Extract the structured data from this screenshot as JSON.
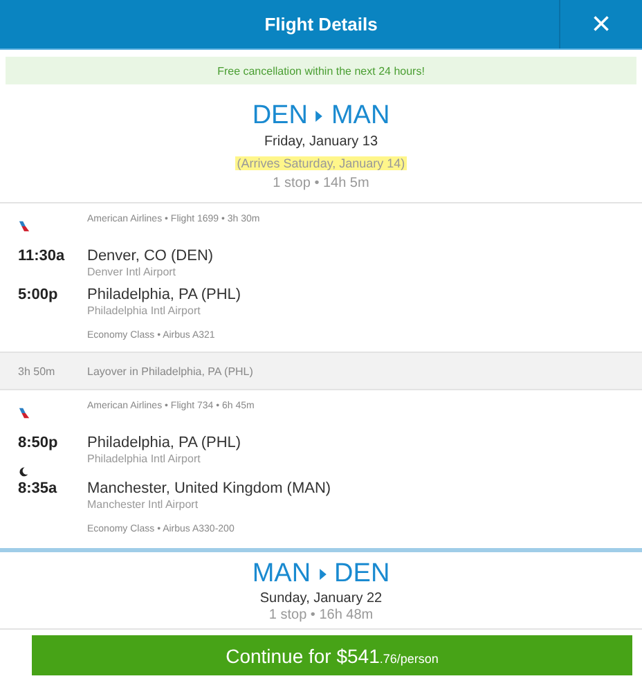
{
  "window": {
    "title": "Flight Details",
    "close": "×"
  },
  "banner": "Free cancellation within the next 24 hours!",
  "outbound": {
    "from": "DEN",
    "to": "MAN",
    "date": "Friday, January 13",
    "arrives": "(Arrives Saturday, January 14)",
    "summary": "1 stop • 14h 5m"
  },
  "items": [
    {
      "kind": "segment",
      "airline": "American Airlines • Flight 1699 • 3h 30m",
      "overnight": false,
      "stops": [
        {
          "time": "11:30a",
          "city": "Denver, CO (DEN)",
          "airport": "Denver Intl Airport"
        },
        {
          "time": "5:00p",
          "city": "Philadelphia, PA (PHL)",
          "airport": "Philadelphia Intl Airport"
        }
      ],
      "cabin": "Economy Class • Airbus A321"
    },
    {
      "kind": "layover",
      "duration": "3h 50m",
      "text": "Layover in Philadelphia, PA (PHL)"
    },
    {
      "kind": "segment",
      "airline": "American Airlines • Flight 734 • 6h 45m",
      "overnight": true,
      "stops": [
        {
          "time": "8:50p",
          "city": "Philadelphia, PA (PHL)",
          "airport": "Philadelphia Intl Airport"
        },
        {
          "time": "8:35a",
          "city": "Manchester, United Kingdom (MAN)",
          "airport": "Manchester Intl Airport"
        }
      ],
      "cabin": "Economy Class • Airbus A330-200"
    }
  ],
  "return": {
    "from": "MAN",
    "to": "DEN",
    "date": "Sunday, January 22",
    "summary": "1 stop • 16h 48m"
  },
  "continue_button": {
    "label": "Continue for $541",
    "cents": ".76/person"
  }
}
